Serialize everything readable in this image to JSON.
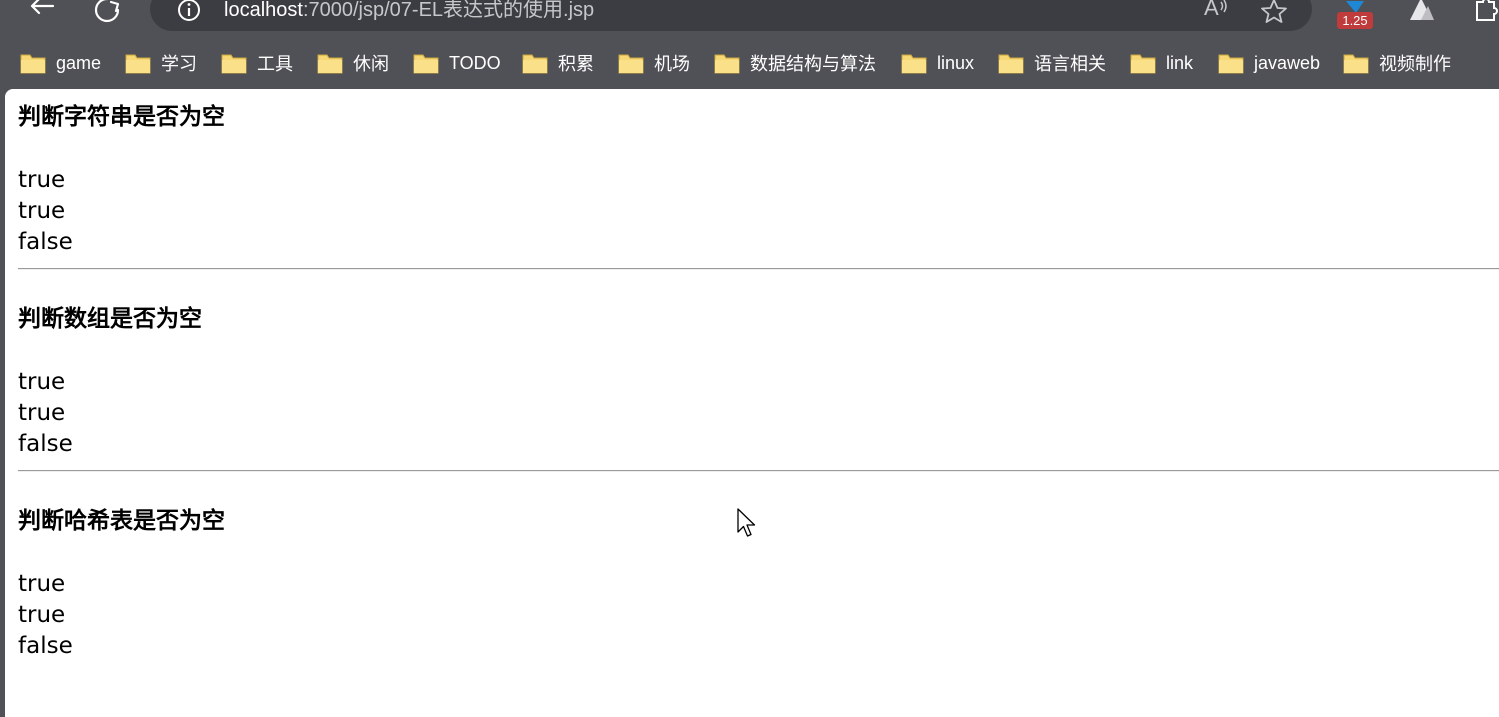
{
  "browser": {
    "url_host": "localhost",
    "url_path": ":7000/jsp/07-EL表达式的使用.jsp",
    "extension_badge": "1.25",
    "icons": [
      "back-arrow-icon",
      "refresh-icon",
      "info-icon",
      "read-aloud-icon",
      "favorite-star-icon",
      "extension-icon",
      "extension-mountain-icon",
      "extensions-puzzle-icon"
    ]
  },
  "bookmarks": [
    {
      "label": "game"
    },
    {
      "label": "学习"
    },
    {
      "label": "工具"
    },
    {
      "label": "休闲"
    },
    {
      "label": "TODO"
    },
    {
      "label": "积累"
    },
    {
      "label": "机场"
    },
    {
      "label": "数据结构与算法"
    },
    {
      "label": "linux"
    },
    {
      "label": "语言相关"
    },
    {
      "label": "link"
    },
    {
      "label": "javaweb"
    },
    {
      "label": "视频制作"
    }
  ],
  "sections": [
    {
      "title": "判断字符串是否为空",
      "values": [
        "true",
        "true",
        "false"
      ]
    },
    {
      "title": "判断数组是否为空",
      "values": [
        "true",
        "true",
        "false"
      ]
    },
    {
      "title": "判断哈希表是否为空",
      "values": [
        "true",
        "true",
        "false"
      ]
    }
  ],
  "colors": {
    "chrome_bg": "#505156",
    "address_bg": "#3c3d42",
    "folder_yellow": "#f8d775",
    "badge_red": "#c03b3b",
    "page_bg": "#ffffff"
  }
}
